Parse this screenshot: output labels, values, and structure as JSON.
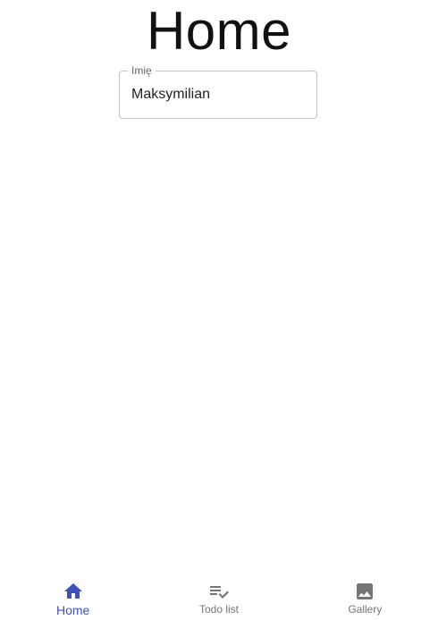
{
  "page": {
    "title": "Home"
  },
  "name_field": {
    "label": "Imię",
    "value": "Maksymilian"
  },
  "bottom_nav": {
    "items": [
      {
        "label": "Home",
        "icon": "home-icon",
        "active": true
      },
      {
        "label": "Todo list",
        "icon": "playlist-check-icon",
        "active": false
      },
      {
        "label": "Gallery",
        "icon": "image-icon",
        "active": false
      }
    ]
  },
  "colors": {
    "accent": "#3f51b5",
    "inactive": "#757575",
    "border": "#c4c4c4"
  }
}
